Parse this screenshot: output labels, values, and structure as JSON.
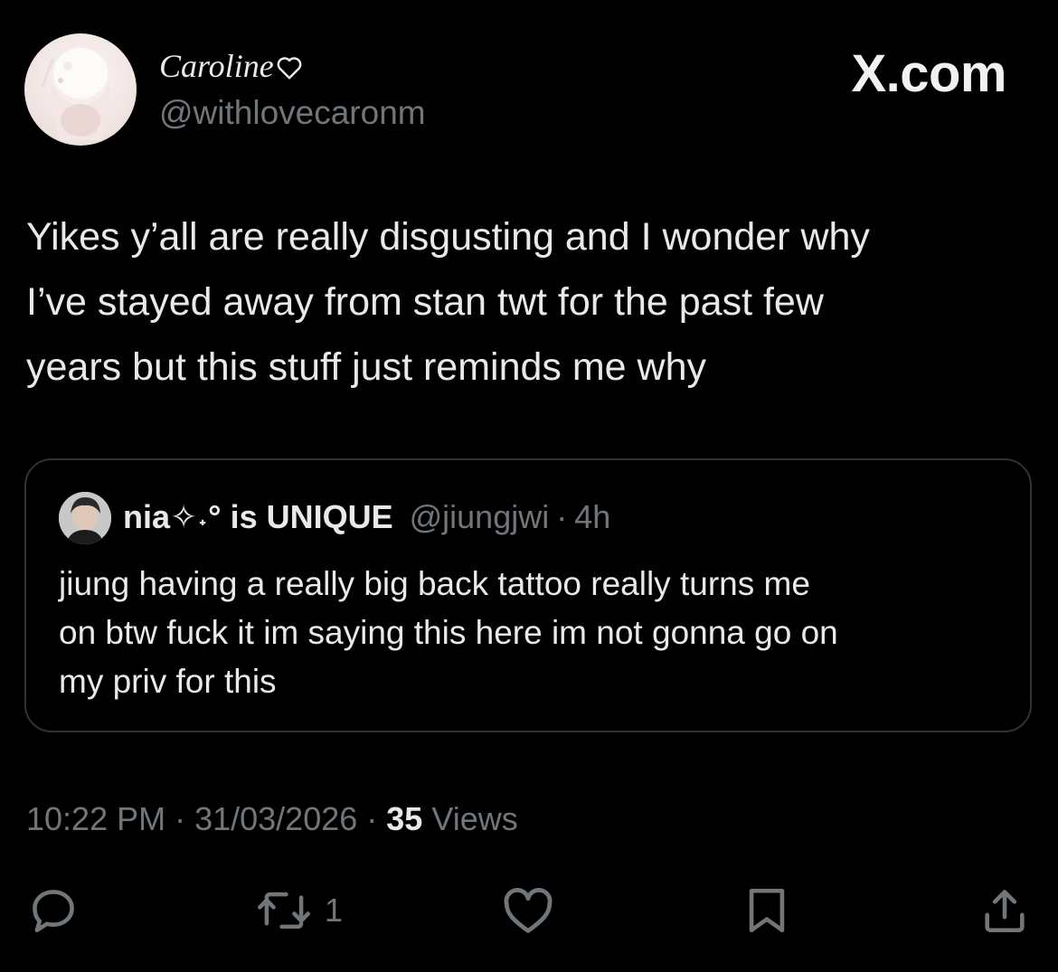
{
  "brand": "X.com",
  "author": {
    "name": "Caroline",
    "handle": "@withlovecaronm"
  },
  "tweet": {
    "lines": [
      "Yikes y’all are really disgusting and I wonder why",
      "I’ve stayed away from stan twt for the past few",
      "years but this stuff just reminds me why"
    ]
  },
  "quote": {
    "name": "nia✧˖° is UNIQUE",
    "handle": "@jiungjwi",
    "separator": "·",
    "time": "4h",
    "lines": [
      "jiung having a really big back tattoo really turns me",
      "on btw fuck it im saying this here im not gonna go on",
      "my priv for this"
    ]
  },
  "meta": {
    "time": "10:22 PM",
    "separator": "·",
    "date": "31/03/2026",
    "views_count": "35",
    "views_label": "Views"
  },
  "actions": {
    "retweet_count": "1",
    "icons": [
      "reply-icon",
      "retweet-icon",
      "like-icon",
      "bookmark-icon",
      "share-icon"
    ]
  },
  "colors": {
    "background": "#000000",
    "text": "#e7e9ea",
    "secondary": "#71767b",
    "border": "#2f3336"
  }
}
